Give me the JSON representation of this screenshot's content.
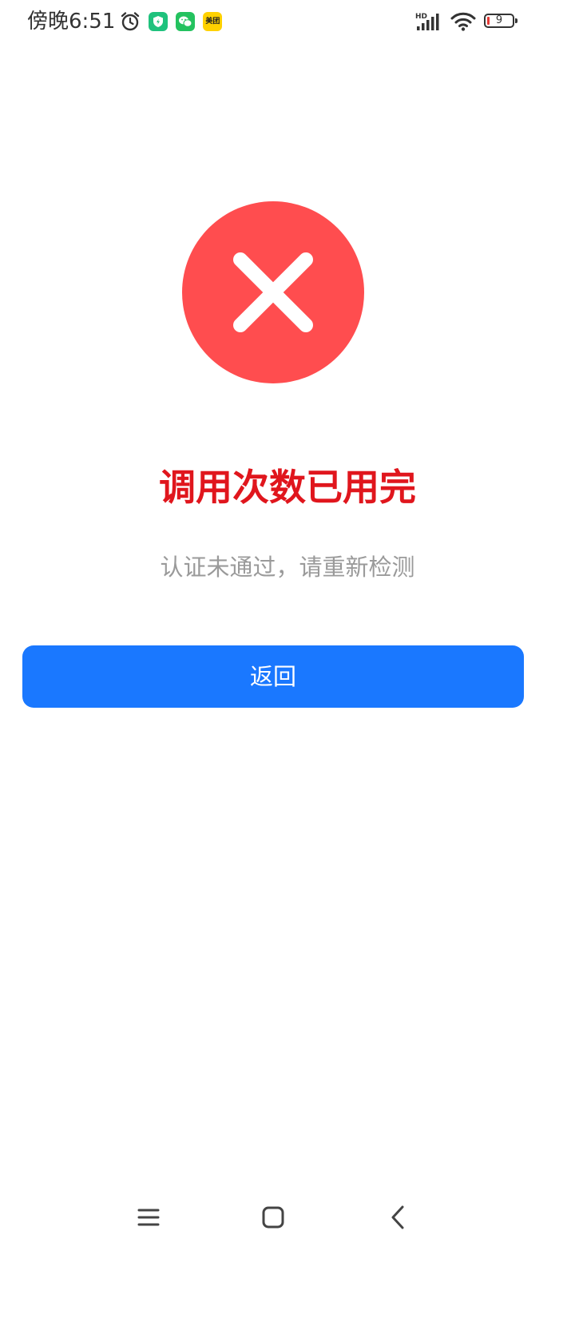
{
  "status_bar": {
    "time": "傍晚6:51",
    "icons": [
      "alarm-icon",
      "shield-app-icon",
      "wechat-app-icon",
      "meituan-app-icon",
      "hd-signal-icon",
      "wifi-icon",
      "battery-icon"
    ],
    "meituan_label": "美团",
    "battery_level": "9",
    "battery_color": "#e53935"
  },
  "result": {
    "icon": "error-x-icon",
    "icon_color": "#ff4d4f",
    "title": "调用次数已用完",
    "title_color": "#e0161d",
    "subtitle": "认证未通过，请重新检测"
  },
  "actions": {
    "back_label": "返回",
    "back_color": "#1a78ff"
  },
  "nav_bar": {
    "icons": [
      "menu-icon",
      "home-icon",
      "back-icon"
    ]
  }
}
